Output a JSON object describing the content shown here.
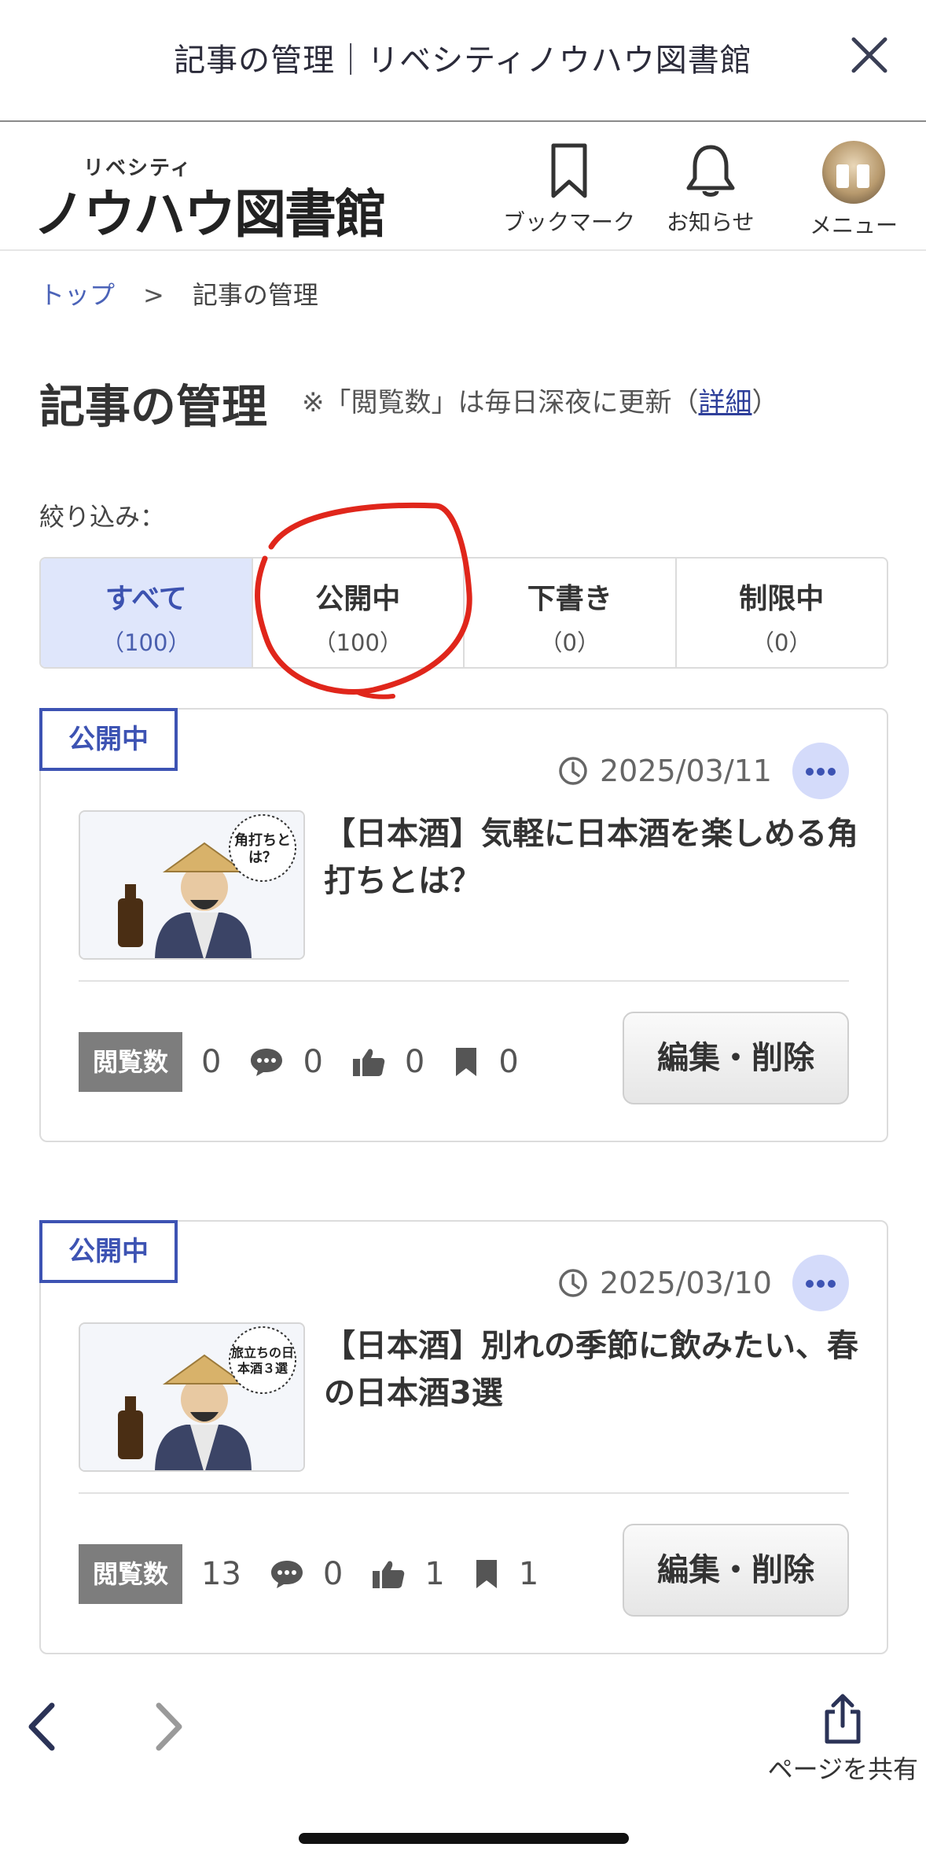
{
  "titlebar": {
    "title": "記事の管理｜リベシティノウハウ図書館"
  },
  "header": {
    "logo_small": "リベシティ",
    "logo_main": "ノウハウ図書館",
    "bookmark_label": "ブックマーク",
    "notice_label": "お知らせ",
    "menu_label": "メニュー"
  },
  "breadcrumb": {
    "home": "トップ",
    "separator": ">",
    "current": "記事の管理"
  },
  "page": {
    "title": "記事の管理",
    "note_prefix": "※「閲覧数」は毎日深夜に更新（",
    "note_link": "詳細",
    "note_suffix": "）",
    "filter_label": "絞り込み："
  },
  "tabs": [
    {
      "label": "すべて",
      "count": "（100）",
      "active": true
    },
    {
      "label": "公開中",
      "count": "（100）",
      "active": false
    },
    {
      "label": "下書き",
      "count": "（0）",
      "active": false
    },
    {
      "label": "制限中",
      "count": "（0）",
      "active": false
    }
  ],
  "articles": [
    {
      "status": "公開中",
      "date": "2025/03/11",
      "title": "【日本酒】気軽に日本酒を楽しめる角打ちとは？",
      "thumb_caption": "角打ちとは？",
      "views_label": "閲覧数",
      "views": "0",
      "comments": "0",
      "likes": "0",
      "bookmarks": "0",
      "edit_label": "編集・削除"
    },
    {
      "status": "公開中",
      "date": "2025/03/10",
      "title": "【日本酒】別れの季節に飲みたい、春の日本酒3選",
      "thumb_caption": "旅立ちの日本酒３選",
      "views_label": "閲覧数",
      "views": "13",
      "comments": "0",
      "likes": "1",
      "bookmarks": "1",
      "edit_label": "編集・削除"
    }
  ],
  "toolbar": {
    "share_label": "ページを共有"
  },
  "colors": {
    "accent": "#3d53b3",
    "active_tab_bg": "#dfe6fb",
    "annotation": "#e0261b"
  }
}
